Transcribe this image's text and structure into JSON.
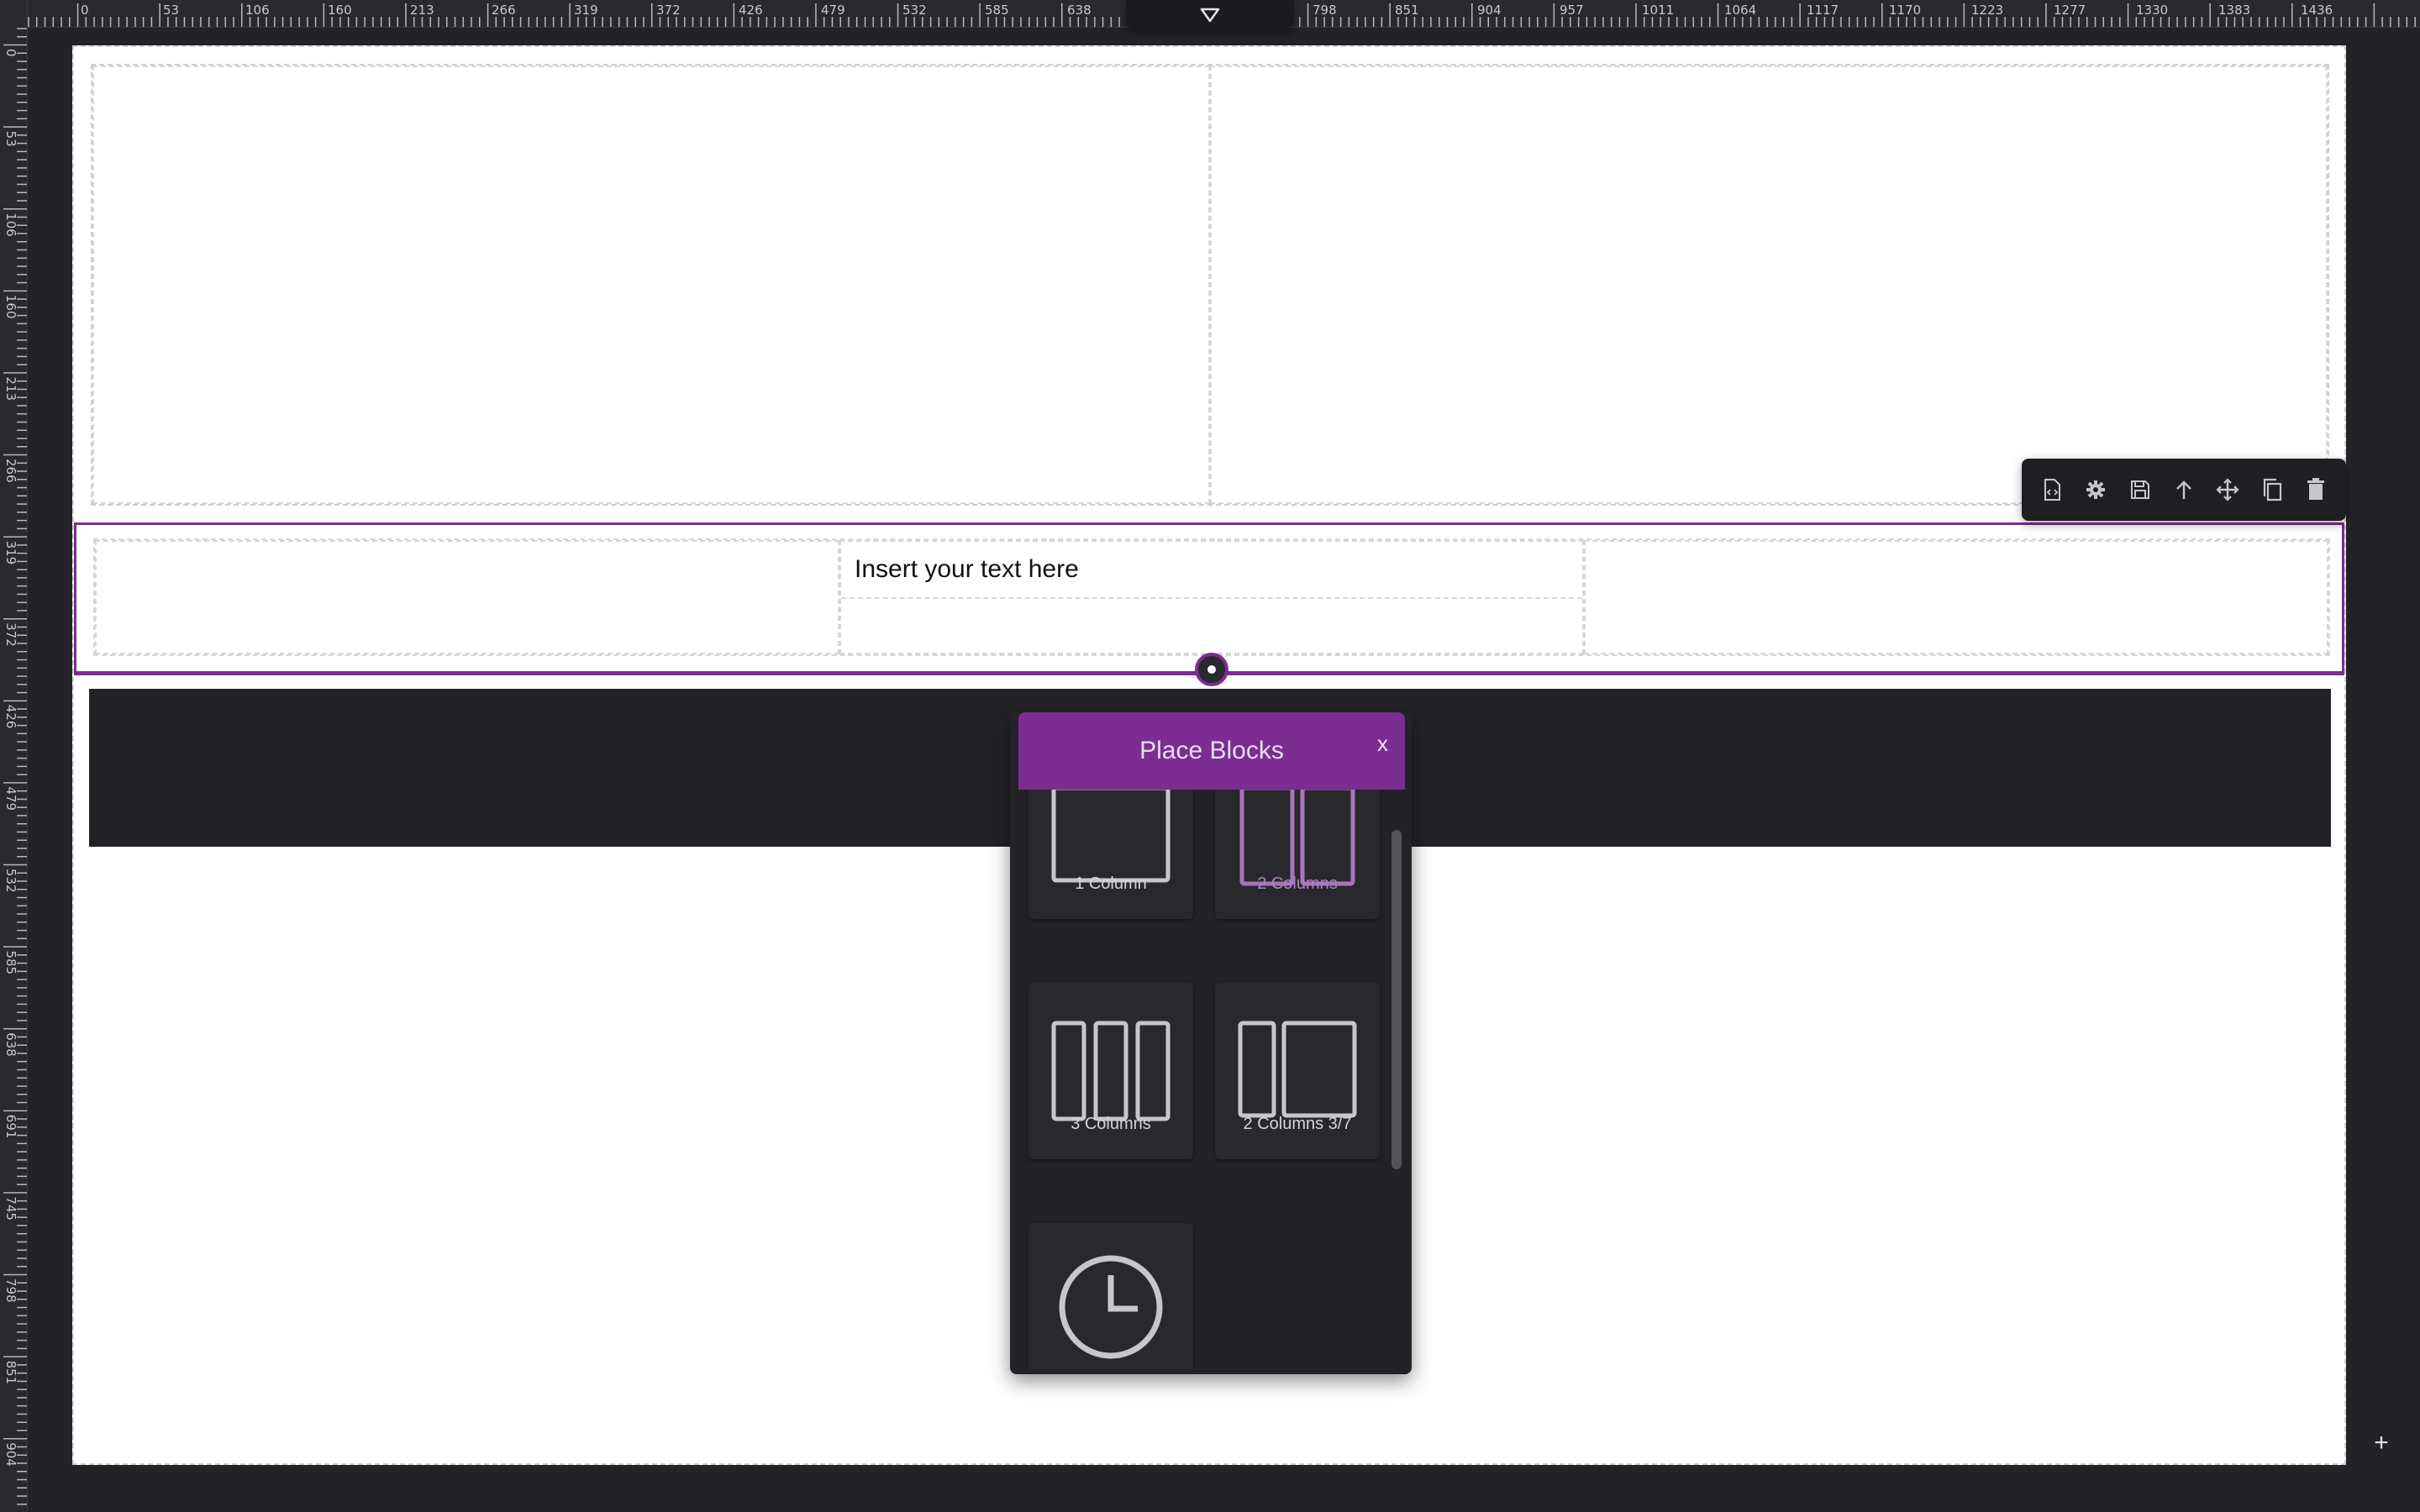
{
  "ruler": {
    "top_ticks": [
      "0",
      "53",
      "106",
      "160",
      "213",
      "266",
      "319",
      "372",
      "426",
      "479",
      "532",
      "585",
      "638",
      "798",
      "851",
      "904",
      "957",
      "1011",
      "1064",
      "1117",
      "1170",
      "1223",
      "1277",
      "1330",
      "1383",
      "1436"
    ],
    "left_ticks": [
      "0",
      "53",
      "106",
      "160",
      "213",
      "266",
      "319",
      "372",
      "426",
      "479",
      "532",
      "585",
      "638",
      "691",
      "745",
      "798",
      "851",
      "904"
    ]
  },
  "canvas": {
    "text_block": "Insert your text here"
  },
  "toolbar": {
    "buttons": [
      "code-icon",
      "gear-icon",
      "save-icon",
      "arrow-up-icon",
      "move-icon",
      "copy-icon",
      "trash-icon"
    ]
  },
  "modal": {
    "title": "Place Blocks",
    "close": "x",
    "tiles": [
      {
        "label": "1 Column",
        "icon": "one-column-icon",
        "active": false
      },
      {
        "label": "2 Columns",
        "icon": "two-columns-icon",
        "active": true
      },
      {
        "label": "3 Columns",
        "icon": "three-columns-icon",
        "active": false
      },
      {
        "label": "2 Columns 3/7",
        "icon": "two-columns-3-7-icon",
        "active": false
      },
      {
        "label": "",
        "icon": "clock-icon",
        "active": false
      }
    ]
  },
  "colors": {
    "accent": "#7b2d91",
    "accent_light": "#b07fc4",
    "panel": "#232226",
    "tile": "#29282c",
    "icon_stroke": "#c9c5cd"
  },
  "actions": {
    "add": "+"
  }
}
